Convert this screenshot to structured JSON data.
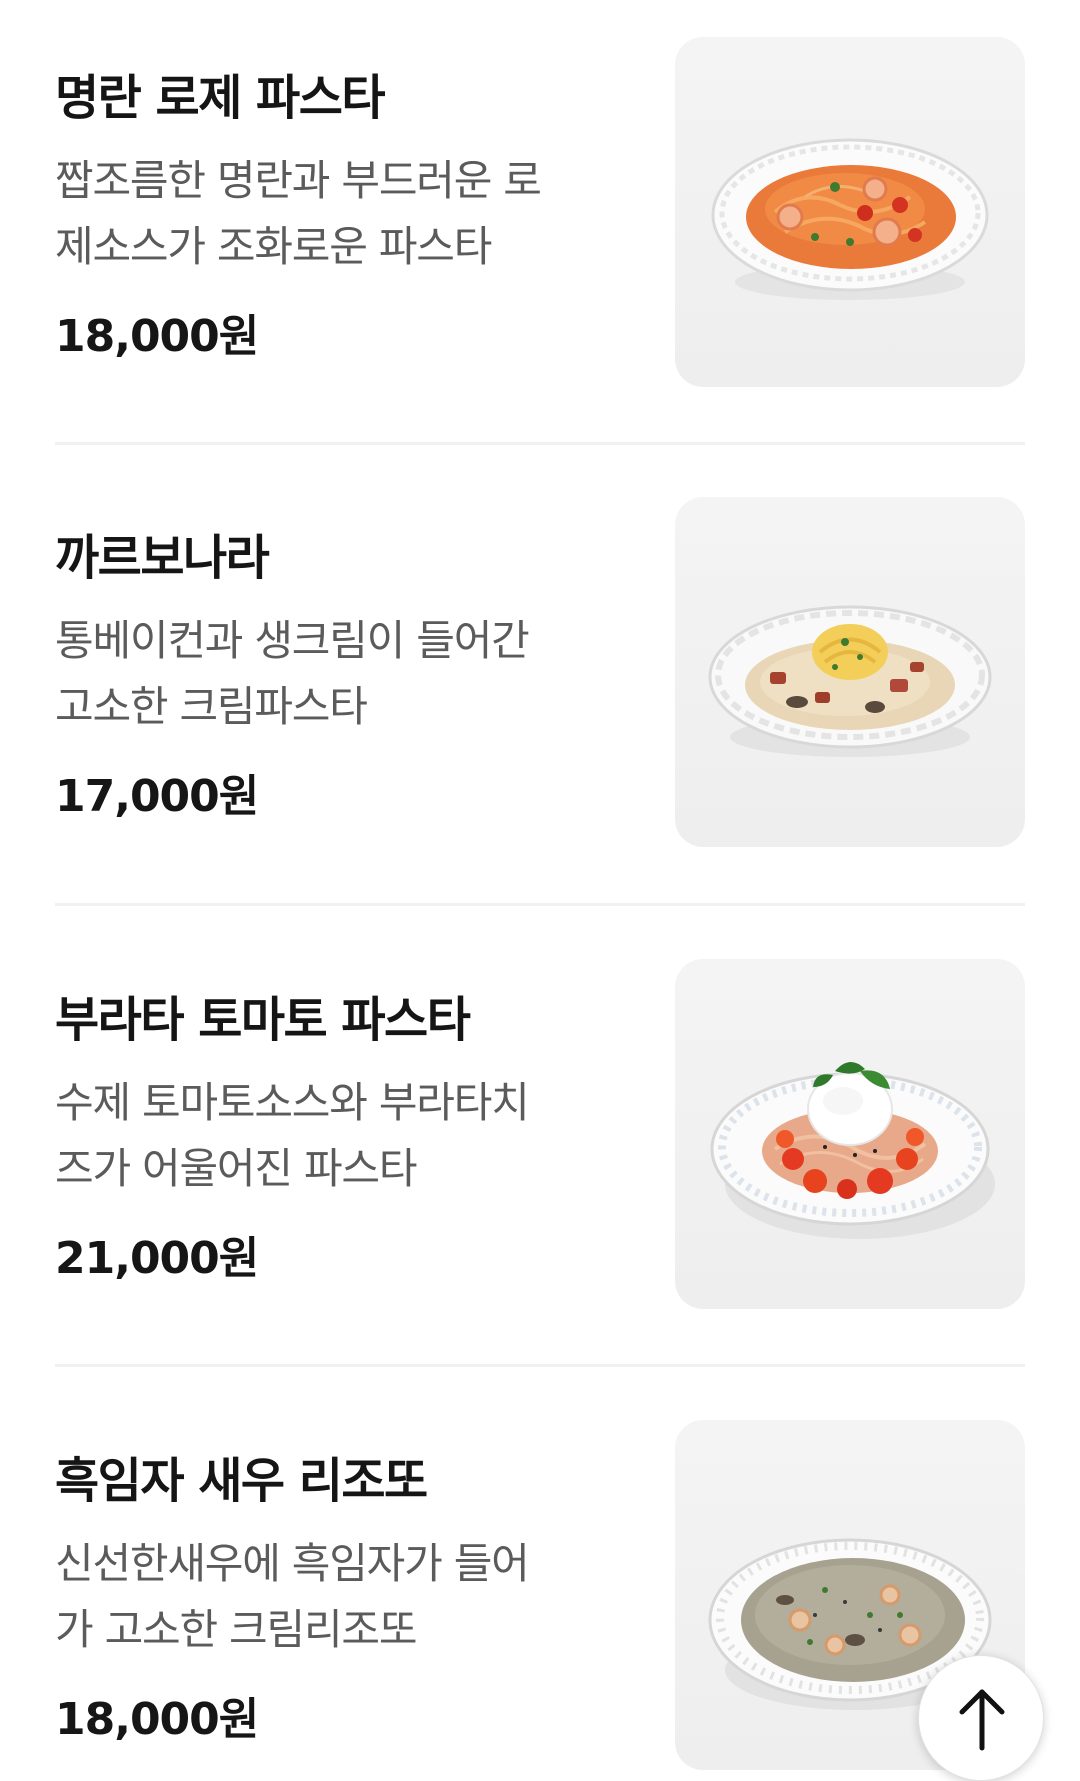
{
  "menu": {
    "items": [
      {
        "name": "명란 로제 파스타",
        "description_lines": [
          "짭조름한 명란과 부드러운 로",
          "제소스가 조화로운 파스타"
        ],
        "price": "18,000원",
        "photo_icon": "rose-pasta-dish-photo"
      },
      {
        "name": "까르보나라",
        "description_lines": [
          "통베이컨과 생크림이 들어간",
          "고소한 크림파스타"
        ],
        "price": "17,000원",
        "photo_icon": "carbonara-dish-photo"
      },
      {
        "name": "부라타 토마토 파스타",
        "description_lines": [
          "수제 토마토소스와 부라타치",
          "즈가 어울어진 파스타"
        ],
        "price": "21,000원",
        "photo_icon": "burrata-pasta-dish-photo"
      },
      {
        "name": "흑임자 새우 리조또",
        "description_lines": [
          "신선한새우에 흑임자가 들어",
          "가 고소한 크림리조또"
        ],
        "price": "18,000원",
        "photo_icon": "black-sesame-risotto-dish-photo"
      }
    ]
  },
  "scroll_top_button": {
    "icon": "arrow-up-icon"
  },
  "colors": {
    "title": "#151515",
    "description": "#5b5b5b",
    "divider": "#f1f1f1",
    "photo_background": "#f0f0f0"
  }
}
